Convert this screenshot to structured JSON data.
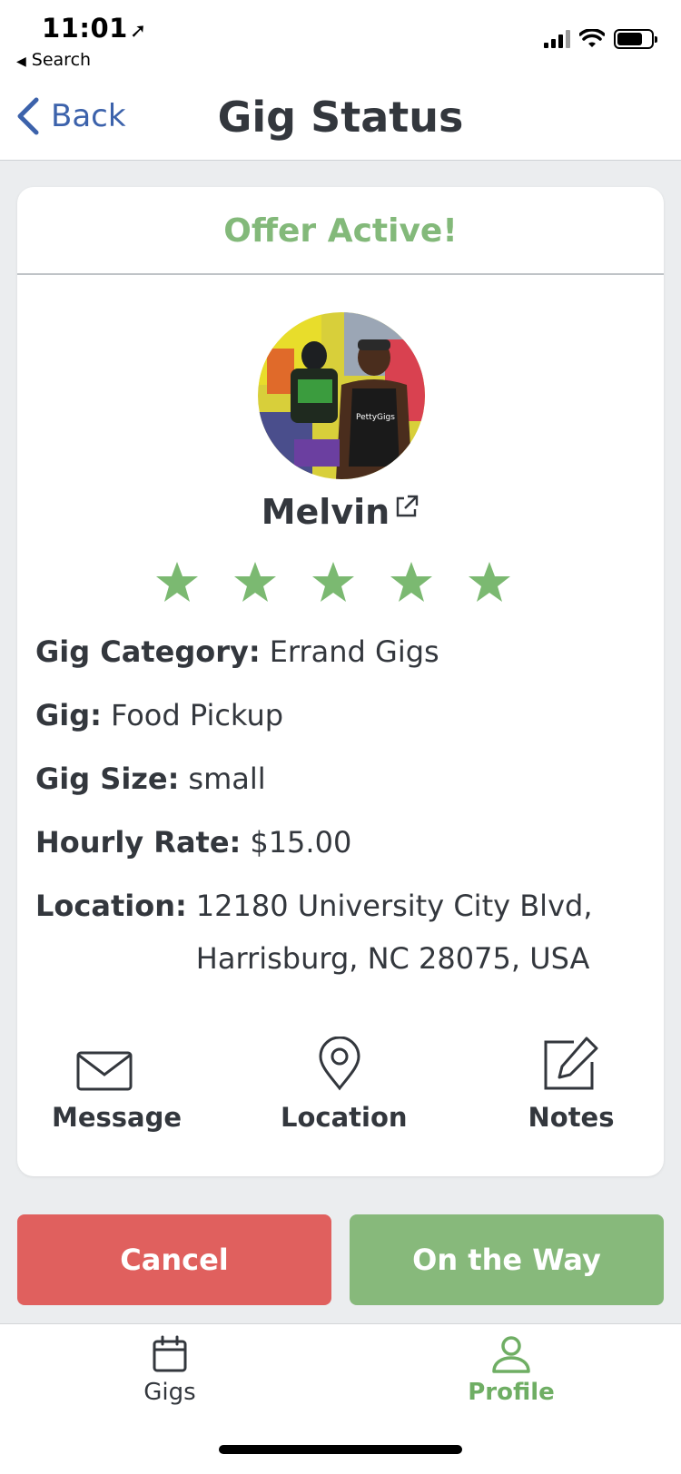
{
  "status_bar": {
    "time": "11:01",
    "back_app": "Search"
  },
  "nav": {
    "back_label": "Back",
    "title": "Gig Status"
  },
  "card": {
    "header": "Offer Active!",
    "profile": {
      "name": "Melvin",
      "rating": 5,
      "rating_max": 5
    },
    "details": [
      {
        "label": "Gig Category:",
        "value": "Errand Gigs"
      },
      {
        "label": "Gig:",
        "value": "Food Pickup"
      },
      {
        "label": "Gig Size:",
        "value": "small"
      },
      {
        "label": "Hourly Rate:",
        "value": "$15.00"
      },
      {
        "label": "Location:",
        "value": "12180 University City Blvd, Harrisburg, NC 28075, USA"
      }
    ],
    "actions": {
      "message": "Message",
      "location": "Location",
      "notes": "Notes"
    }
  },
  "buttons": {
    "cancel": "Cancel",
    "on_the_way": "On the Way"
  },
  "tabs": {
    "gigs": "Gigs",
    "profile": "Profile",
    "active": "profile"
  },
  "colors": {
    "accent_green": "#87b97b",
    "cancel_red": "#e0605e",
    "link_blue": "#3c62ab"
  },
  "icons": {
    "back": "chevron-left-icon",
    "external_link": "external-link-icon",
    "star": "star-icon",
    "message": "envelope-icon",
    "location": "map-pin-icon",
    "notes": "edit-icon",
    "gigs_tab": "calendar-icon",
    "profile_tab": "user-icon"
  }
}
